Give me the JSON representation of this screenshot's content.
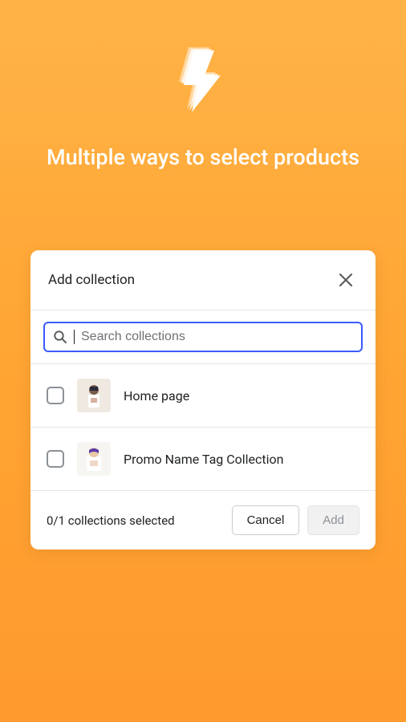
{
  "hero": {
    "title": "Multiple ways to select products"
  },
  "modal": {
    "title": "Add collection",
    "search": {
      "placeholder": "Search collections",
      "value": ""
    },
    "items": [
      {
        "label": "Home page",
        "checked": false
      },
      {
        "label": "Promo Name Tag Collection",
        "checked": false
      }
    ],
    "footer": {
      "selected_text": "0/1 collections selected",
      "cancel_label": "Cancel",
      "add_label": "Add"
    }
  },
  "icons": {
    "bolt": "lightning-bolt-icon",
    "close": "close-icon",
    "search": "search-icon"
  }
}
